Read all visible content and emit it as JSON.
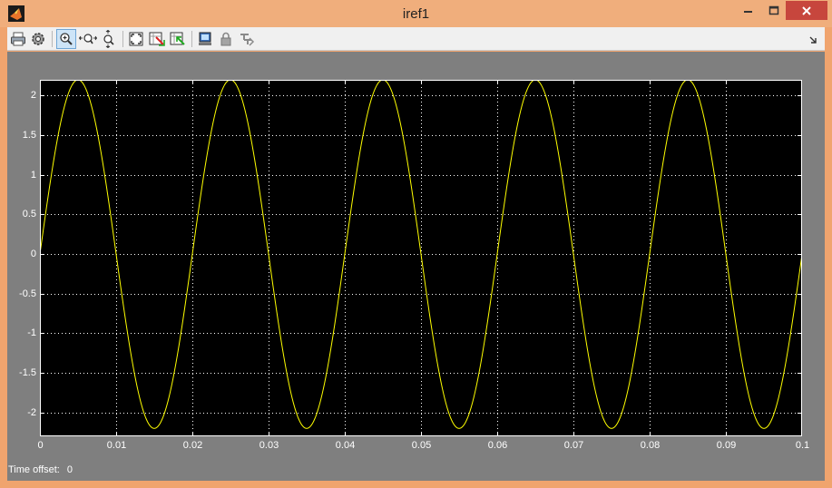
{
  "window": {
    "title": "iref1"
  },
  "toolbar": {
    "buttons": [
      {
        "name": "print-icon"
      },
      {
        "name": "parameters-icon"
      },
      {
        "name": "zoom-in-icon"
      },
      {
        "name": "zoom-x-icon"
      },
      {
        "name": "zoom-y-icon"
      },
      {
        "name": "autoscale-icon"
      },
      {
        "name": "save-axes-icon"
      },
      {
        "name": "restore-axes-icon"
      },
      {
        "name": "floating-scope-icon"
      },
      {
        "name": "lock-icon"
      },
      {
        "name": "signal-selection-icon"
      }
    ]
  },
  "status": {
    "offset_label": "Time offset:",
    "offset_value": "0"
  },
  "colors": {
    "trace": "#ffff00",
    "plot_bg": "#000000",
    "panel": "#7f7f7f",
    "titlebar": "#f0ae7c",
    "close": "#c7463d"
  },
  "chart_data": {
    "type": "line",
    "x_ticks": [
      "0",
      "0.01",
      "0.02",
      "0.03",
      "0.04",
      "0.05",
      "0.06",
      "0.07",
      "0.08",
      "0.09",
      "0.1"
    ],
    "y_ticks": [
      "2",
      "1.5",
      "1",
      "0.5",
      "0",
      "-0.5",
      "-1",
      "-1.5",
      "-2"
    ],
    "xlim": [
      0,
      0.1
    ],
    "ylim": [
      -2.3,
      2.2
    ],
    "grid": true,
    "series": [
      {
        "function": "sine",
        "amplitude": 2.2,
        "frequency_hz": 50,
        "phase": 0,
        "color": "#ffff00"
      }
    ]
  }
}
